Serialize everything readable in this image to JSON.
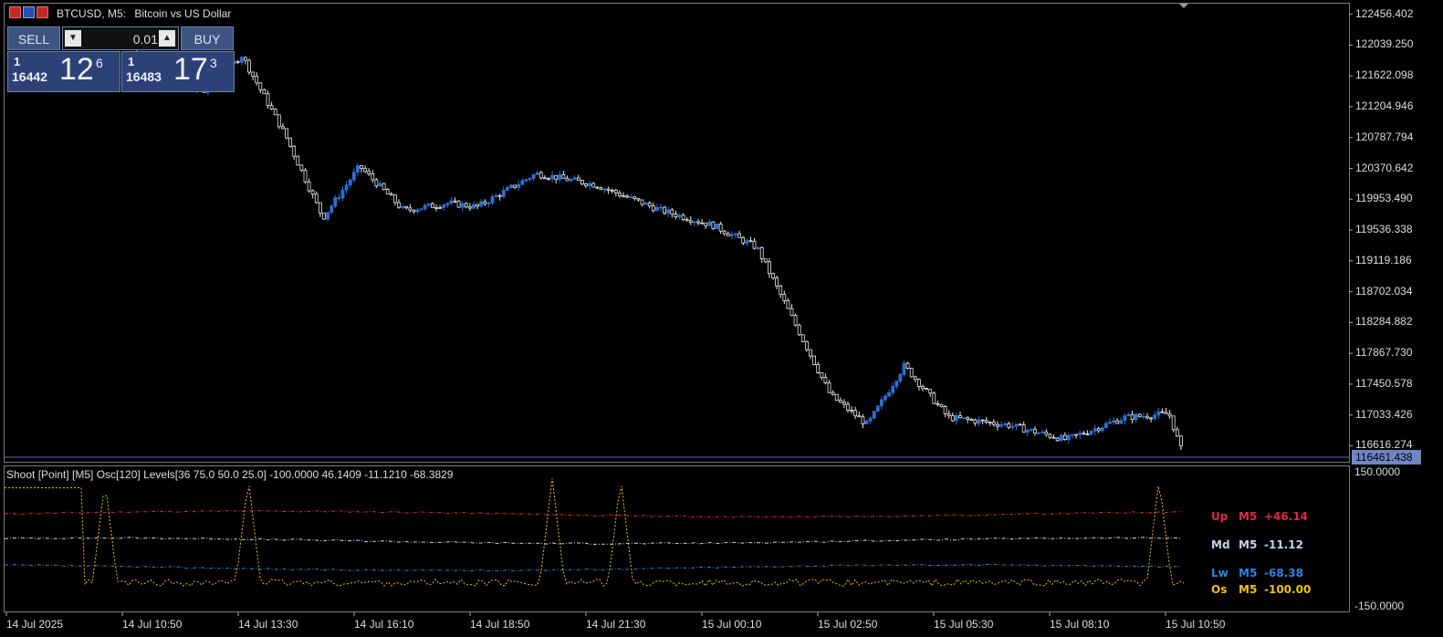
{
  "header": {
    "symbol": "BTCUSD, M5:",
    "description": "Bitcoin vs US Dollar"
  },
  "trade_panel": {
    "sell_label": "SELL",
    "buy_label": "BUY",
    "lot_value": "0.01",
    "sell_quote": {
      "top": "1",
      "big_prefix": "16442",
      "big": "12",
      "sup": "6"
    },
    "buy_quote": {
      "top": "1",
      "big_prefix": "16483",
      "big": "17",
      "sup": "3"
    }
  },
  "price_axis": {
    "ticks": [
      "122456.402",
      "122039.250",
      "121622.098",
      "121204.946",
      "120787.794",
      "120370.642",
      "119953.490",
      "119536.338",
      "119119.186",
      "118702.034",
      "118284.882",
      "117867.730",
      "117450.578",
      "117033.426",
      "116616.274"
    ],
    "current_price": "116461.438"
  },
  "time_axis": {
    "ticks": [
      "14 Jul 2025",
      "14 Jul 10:50",
      "14 Jul 13:30",
      "14 Jul 16:10",
      "14 Jul 18:50",
      "14 Jul 21:30",
      "15 Jul 00:10",
      "15 Jul 02:50",
      "15 Jul 05:30",
      "15 Jul 08:10",
      "15 Jul 10:50"
    ]
  },
  "indicator": {
    "label": "Shoot [Point] [M5]  Osc[120]  Levels[36 75.0 50.0 25.0] -100.0000 46.1409 -11.1210 -68.3829",
    "y_top": "150.0000",
    "y_bottom": "-150.0000",
    "legend": [
      {
        "name": "Up",
        "tf": "M5",
        "value": "+46.14",
        "color": "#e0264a"
      },
      {
        "name": "Md",
        "tf": "M5",
        "value": "-11.12",
        "color": "#c8d2e6"
      },
      {
        "name": "Lw",
        "tf": "M5",
        "value": "-68.38",
        "color": "#2d82e8"
      },
      {
        "name": "Os",
        "tf": "M5",
        "value": "-100.00",
        "color": "#f2c200"
      }
    ]
  },
  "colors": {
    "bull": "#2b6fd6",
    "bear": "#e8e8e8",
    "grid": "#7a7a7a",
    "current_line": "#4f6fc4"
  },
  "chart_data": {
    "type": "candlestick",
    "symbol": "BTCUSD",
    "timeframe": "M5",
    "ylim": [
      116400,
      122600
    ],
    "close_path": [
      {
        "t": "14 Jul 2025",
        "close": 121950
      },
      {
        "t": "14 Jul 10:50",
        "close": 121700
      },
      {
        "t": "14 Jul 12:40",
        "close": 121400
      },
      {
        "t": "14 Jul 13:30",
        "close": 121900
      },
      {
        "t": "14 Jul 14:30",
        "close": 120800
      },
      {
        "t": "14 Jul 15:20",
        "close": 119700
      },
      {
        "t": "14 Jul 16:10",
        "close": 120400
      },
      {
        "t": "14 Jul 17:10",
        "close": 119800
      },
      {
        "t": "14 Jul 18:10",
        "close": 119900
      },
      {
        "t": "14 Jul 18:50",
        "close": 119850
      },
      {
        "t": "14 Jul 20:10",
        "close": 120300
      },
      {
        "t": "14 Jul 21:30",
        "close": 120150
      },
      {
        "t": "14 Jul 23:00",
        "close": 119800
      },
      {
        "t": "15 Jul 00:10",
        "close": 119600
      },
      {
        "t": "15 Jul 01:10",
        "close": 119300
      },
      {
        "t": "15 Jul 02:00",
        "close": 118300
      },
      {
        "t": "15 Jul 02:50",
        "close": 117300
      },
      {
        "t": "15 Jul 03:40",
        "close": 116900
      },
      {
        "t": "15 Jul 04:30",
        "close": 117700
      },
      {
        "t": "15 Jul 05:30",
        "close": 117000
      },
      {
        "t": "15 Jul 06:50",
        "close": 116900
      },
      {
        "t": "15 Jul 08:10",
        "close": 116700
      },
      {
        "t": "15 Jul 09:30",
        "close": 117000
      },
      {
        "t": "15 Jul 10:30",
        "close": 117050
      },
      {
        "t": "15 Jul 10:50",
        "close": 116460
      }
    ],
    "indicator_levels": {
      "up": 46.14,
      "md": -11.12,
      "lw": -68.38,
      "os": -100.0
    }
  }
}
